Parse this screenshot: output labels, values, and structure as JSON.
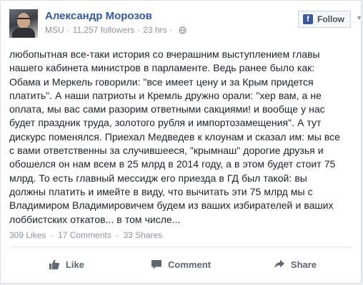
{
  "post": {
    "author": "Александр Морозов",
    "source": "MSU",
    "followers": "11,257 followers",
    "time": "23 hrs",
    "privacy_icon": "globe-icon",
    "follow_label": "Follow",
    "text_lines": [
      "любопытная все-таки история со вчерашним выступлением главы",
      "нашего кабинета министров в парламенте. Ведь ранее было как:",
      "Обама и Меркель говорили: \"все имеет цену и за Крым придется",
      "платить\". А наши патриоты и Кремль дружно орали: \"хер вам, а не",
      "оплата, мы вас сами разорим ответными сакциями! и вообще у нас",
      "будет праздник труда, золотого рубля и импортозамещения\". А тут",
      "дискурс поменялся. Приехал Медведев к клоунам и сказал им: мы все",
      "с вами ответственны за случившееся, \"крымнаш\" дорогие друзья и",
      "обошелся он нам всем в 25 млрд в 2014 году, а в этом будет стоит 75",
      "млрд. То есть главный мессидж его приезда в ГД был такой: вы",
      "должны платить и имейте в виду, что вычитать эти 75 млрд мы с",
      "Владимиром Владимировичем будем из ваших избирателей и ваших",
      "лоббистских откатов... в том числе..."
    ]
  },
  "stats": {
    "likes": "309 Likes",
    "comments": "17 Comments",
    "shares": "33 Shares"
  },
  "actions": {
    "like": "Like",
    "comment": "Comment",
    "share": "Share"
  },
  "colors": {
    "author_link": "#365899",
    "facebook_blue": "#3b5998",
    "meta_gray": "#90949c",
    "text": "#1d2129"
  }
}
